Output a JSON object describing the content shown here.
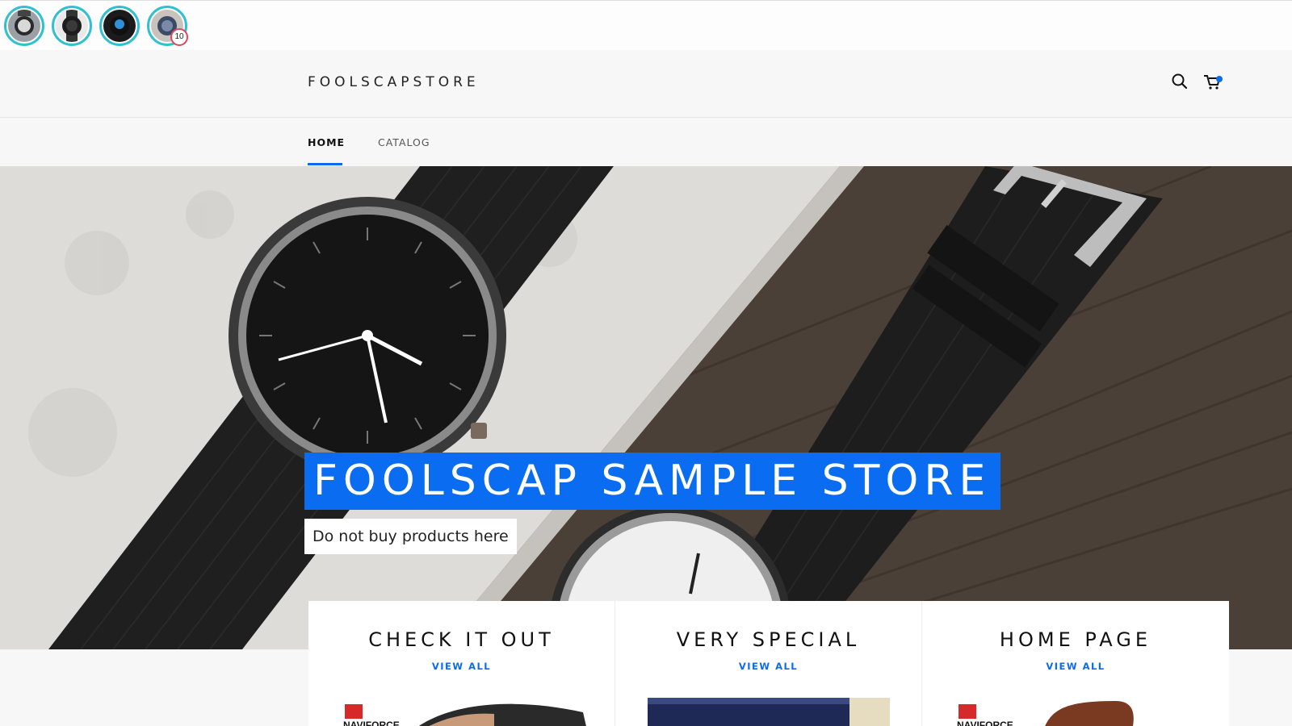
{
  "story_bar": {
    "stories": [
      {
        "name": "story-1",
        "badge": ""
      },
      {
        "name": "story-2",
        "badge": ""
      },
      {
        "name": "story-3",
        "badge": ""
      },
      {
        "name": "story-4",
        "badge": "10"
      }
    ],
    "ring_color": "#2fc1d0"
  },
  "header": {
    "logo": "FOOLSCAPSTORE",
    "icons": [
      "search-icon",
      "cart-icon"
    ],
    "cart_dot_color": "#0b6bf0"
  },
  "nav": {
    "items": [
      {
        "label": "HOME",
        "active": true
      },
      {
        "label": "CATALOG",
        "active": false
      }
    ]
  },
  "hero": {
    "title": "FOOLSCAP SAMPLE STORE",
    "subtitle": "Do not buy products here",
    "accent": "#0a6cf1"
  },
  "collections": [
    {
      "title": "CHECK IT OUT",
      "link": "VIEW ALL",
      "brand": "NAVIFORCE"
    },
    {
      "title": "VERY SPECIAL",
      "link": "VIEW ALL",
      "brand": ""
    },
    {
      "title": "HOME PAGE",
      "link": "VIEW ALL",
      "brand": "NAVIFORCE"
    }
  ]
}
